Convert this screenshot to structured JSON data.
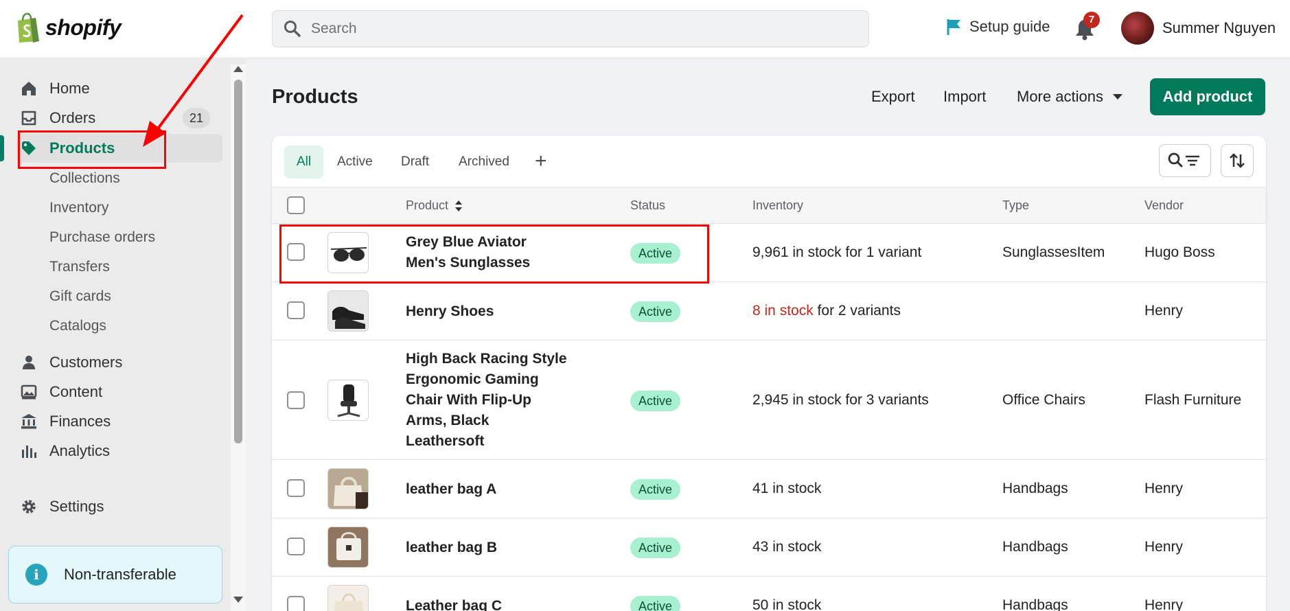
{
  "brand": {
    "name": "shopify",
    "logo_icon": "shopify-bag-icon",
    "accent": "#008060"
  },
  "topbar": {
    "search_placeholder": "Search",
    "setup_guide": "Setup guide",
    "notifications_count": "7",
    "user_name": "Summer Nguyen"
  },
  "sidebar": {
    "items": [
      {
        "label": "Home",
        "icon": "home-icon"
      },
      {
        "label": "Orders",
        "icon": "inbox-icon",
        "badge": "21"
      },
      {
        "label": "Products",
        "icon": "tag-icon",
        "active": true
      },
      {
        "label": "Customers",
        "icon": "person-icon"
      },
      {
        "label": "Content",
        "icon": "image-icon"
      },
      {
        "label": "Finances",
        "icon": "bank-icon"
      },
      {
        "label": "Analytics",
        "icon": "bar-chart-icon"
      },
      {
        "label": "Settings",
        "icon": "gear-icon"
      }
    ],
    "product_subitems": [
      "Collections",
      "Inventory",
      "Purchase orders",
      "Transfers",
      "Gift cards",
      "Catalogs"
    ],
    "notice": "Non-transferable"
  },
  "page": {
    "title": "Products",
    "export": "Export",
    "import": "Import",
    "more_actions": "More actions",
    "add_product": "Add product"
  },
  "tabs": [
    "All",
    "Active",
    "Draft",
    "Archived"
  ],
  "table": {
    "headers": {
      "product": "Product",
      "status": "Status",
      "inventory": "Inventory",
      "type": "Type",
      "vendor": "Vendor"
    },
    "rows": [
      {
        "name": "Grey Blue Aviator Men's Sunglasses",
        "status": "Active",
        "inventory": "9,961 in stock for 1 variant",
        "type": "SunglassesItem",
        "vendor": "Hugo Boss"
      },
      {
        "name": "Henry Shoes",
        "status": "Active",
        "inventory_low": "8 in stock",
        "inventory_rest": " for 2 variants",
        "type": "",
        "vendor": "Henry"
      },
      {
        "name": "High Back Racing Style Ergonomic Gaming Chair With Flip-Up Arms, Black Leathersoft",
        "status": "Active",
        "inventory": "2,945 in stock for 3 variants",
        "type": "Office Chairs",
        "vendor": "Flash Furniture"
      },
      {
        "name": "leather bag A",
        "status": "Active",
        "inventory": "41 in stock",
        "type": "Handbags",
        "vendor": "Henry"
      },
      {
        "name": "leather bag B",
        "status": "Active",
        "inventory": "43 in stock",
        "type": "Handbags",
        "vendor": "Henry"
      },
      {
        "name": "Leather bag C",
        "status": "Active",
        "inventory": "50 in stock",
        "type": "Handbags",
        "vendor": "Henry"
      }
    ]
  }
}
